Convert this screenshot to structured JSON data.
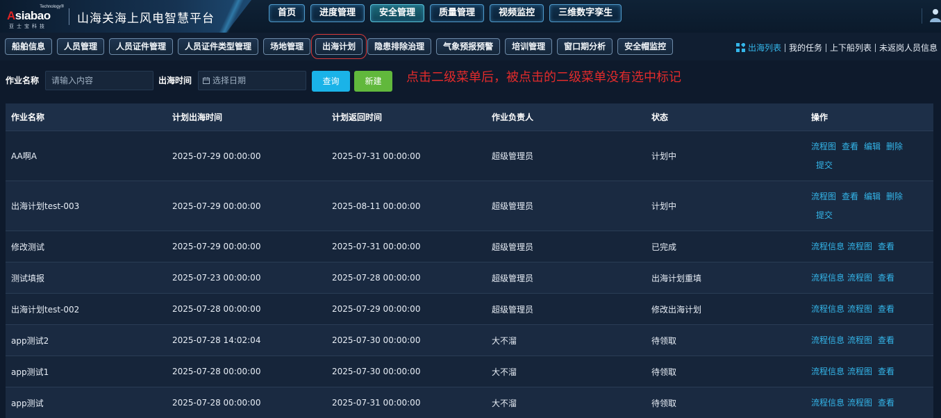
{
  "brand": {
    "logo_tech": "Technology®",
    "logo_mark_a": "A",
    "logo_mark_rest": "siabao",
    "logo_sub": "亚士宝科技",
    "app_title": "山海关海上风电智慧平台"
  },
  "main_nav": [
    {
      "label": "首页",
      "active": false
    },
    {
      "label": "进度管理",
      "active": false
    },
    {
      "label": "安全管理",
      "active": true
    },
    {
      "label": "质量管理",
      "active": false
    },
    {
      "label": "视频监控",
      "active": false
    },
    {
      "label": "三维数字孪生",
      "active": false
    }
  ],
  "sub_nav": [
    {
      "label": "船舶信息"
    },
    {
      "label": "人员管理"
    },
    {
      "label": "人员证件管理"
    },
    {
      "label": "人员证件类型管理"
    },
    {
      "label": "场地管理"
    },
    {
      "label": "出海计划",
      "highlighted": true
    },
    {
      "label": "隐患排除治理"
    },
    {
      "label": "气象预报预警"
    },
    {
      "label": "培训管理"
    },
    {
      "label": "窗口期分析"
    },
    {
      "label": "安全帽监控"
    }
  ],
  "quick_links": [
    "出海列表",
    "我的任务",
    "上下船列表",
    "未返岗人员信息"
  ],
  "filters": {
    "job_name_label": "作业名称",
    "job_name_placeholder": "请输入内容",
    "sea_time_label": "出海时间",
    "date_placeholder": "选择日期",
    "query_label": "查询",
    "add_label": "新建"
  },
  "annotation": "点击二级菜单后，被点击的二级菜单没有选中标记",
  "table": {
    "headers": [
      "作业名称",
      "计划出海时间",
      "计划返回时间",
      "作业负责人",
      "状态",
      "操作"
    ],
    "rows": [
      {
        "name": "AA啊A",
        "out": "2025-07-29 00:00:00",
        "back": "2025-07-31 00:00:00",
        "owner": "超级管理员",
        "status": "计划中",
        "ops": [
          "流程图",
          "查看",
          "编辑",
          "删除",
          "提交"
        ]
      },
      {
        "name": "出海计划test-003",
        "out": "2025-07-29 00:00:00",
        "back": "2025-08-11 00:00:00",
        "owner": "超级管理员",
        "status": "计划中",
        "ops": [
          "流程图",
          "查看",
          "编辑",
          "删除",
          "提交"
        ]
      },
      {
        "name": "修改测试",
        "out": "2025-07-29 00:00:00",
        "back": "2025-07-31 00:00:00",
        "owner": "超级管理员",
        "status": "已完成",
        "ops": [
          "流程信息",
          "流程图",
          "查看"
        ]
      },
      {
        "name": "测试填报",
        "out": "2025-07-23 00:00:00",
        "back": "2025-07-28 00:00:00",
        "owner": "超级管理员",
        "status": "出海计划重填",
        "ops": [
          "流程信息",
          "流程图",
          "查看"
        ]
      },
      {
        "name": "出海计划test-002",
        "out": "2025-07-28 00:00:00",
        "back": "2025-07-29 00:00:00",
        "owner": "超级管理员",
        "status": "修改出海计划",
        "ops": [
          "流程信息",
          "流程图",
          "查看"
        ]
      },
      {
        "name": "app测试2",
        "out": "2025-07-28 14:02:04",
        "back": "2025-07-30 00:00:00",
        "owner": "大不溜",
        "status": "待领取",
        "ops": [
          "流程信息",
          "流程图",
          "查看"
        ]
      },
      {
        "name": "app测试1",
        "out": "2025-07-28 00:00:00",
        "back": "2025-07-30 00:00:00",
        "owner": "大不溜",
        "status": "待领取",
        "ops": [
          "流程信息",
          "流程图",
          "查看"
        ]
      },
      {
        "name": "app测试",
        "out": "2025-07-28 00:00:00",
        "back": "2025-07-31 00:00:00",
        "owner": "大不溜",
        "status": "待领取",
        "ops": [
          "流程信息",
          "流程图",
          "查看"
        ]
      }
    ]
  },
  "colors": {
    "accent": "#34b6ea",
    "query_button": "#1ab3e8",
    "add_button": "#61b83c",
    "annotation": "#e22b2b",
    "highlight_ring": "#d93a3a"
  },
  "icons": {
    "user": "user-icon",
    "quicklinks": "grid-icon",
    "date": "calendar-icon"
  }
}
